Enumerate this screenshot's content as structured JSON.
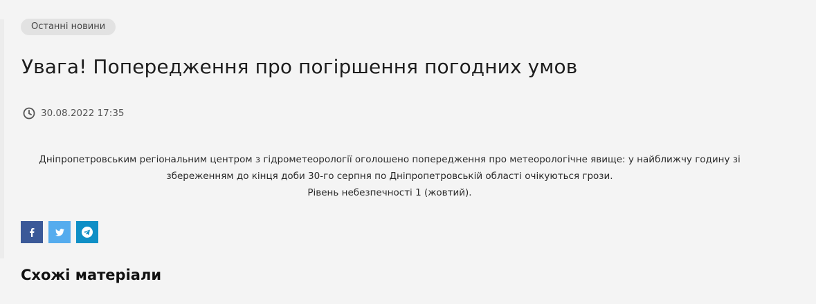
{
  "category_tag": "Останні новини",
  "article": {
    "title": "Увага! Попередження про погіршення погодних умов",
    "date": "30.08.2022 17:35",
    "paragraphs": [
      "Дніпропетровським регіональним центром з гідрометеорології оголошено попередження про метеорологічне явище: у найближчу годину зі збереженням до кінця доби 30-го серпня по Дніпропетровській області очікуються грози.",
      "Рівень небезпечності 1 (жовтий)."
    ]
  },
  "share": {
    "facebook_icon": "facebook-icon",
    "twitter_icon": "twitter-icon",
    "telegram_icon": "telegram-icon",
    "colors": {
      "facebook": "#3b5998",
      "twitter": "#55acee",
      "telegram": "#0f8fc6"
    }
  },
  "related": {
    "heading": "Схожі матеріали"
  }
}
